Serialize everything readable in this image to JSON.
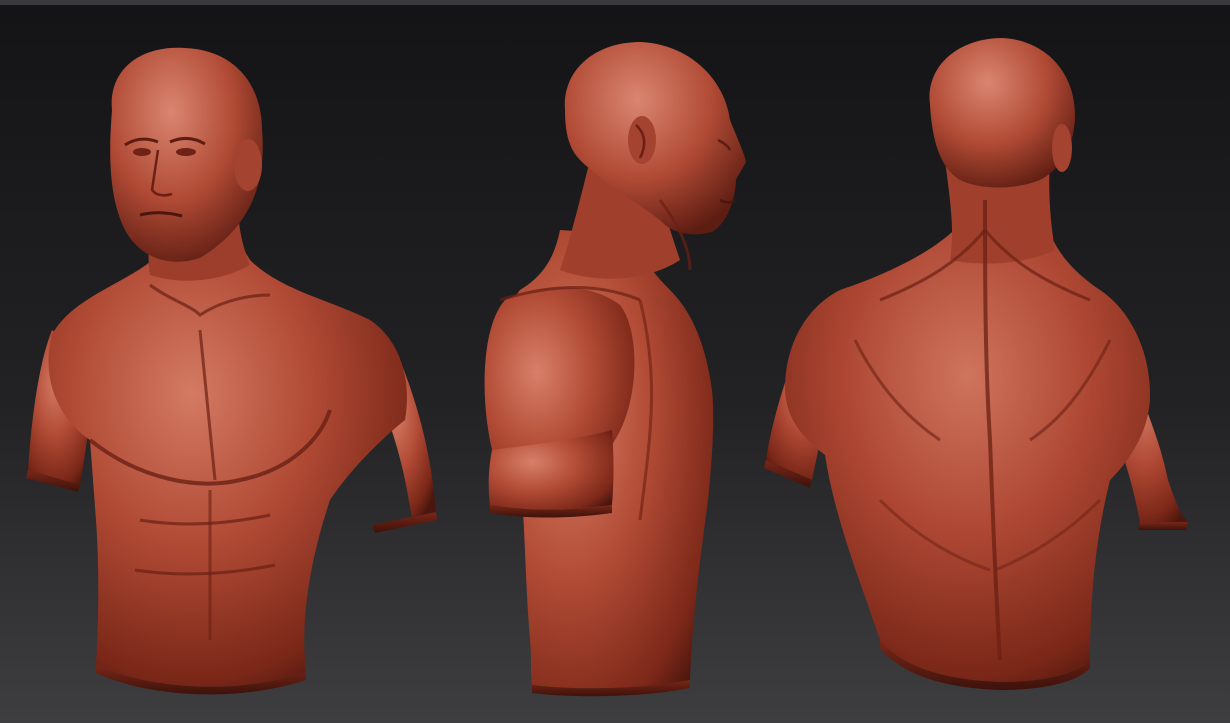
{
  "scene": {
    "background_top": "#141416",
    "background_bottom": "#3e3e40",
    "top_strip_color": "#3a3a3e",
    "clay_base": "#a8432f",
    "clay_highlight": "#d9806a",
    "clay_shadow": "#5a1c12",
    "clay_deep": "#3d120b"
  },
  "views": [
    {
      "name": "front-three-quarter-view",
      "subject": "male-torso-bust"
    },
    {
      "name": "side-profile-view",
      "subject": "male-torso-bust"
    },
    {
      "name": "back-three-quarter-view",
      "subject": "male-torso-bust"
    }
  ]
}
